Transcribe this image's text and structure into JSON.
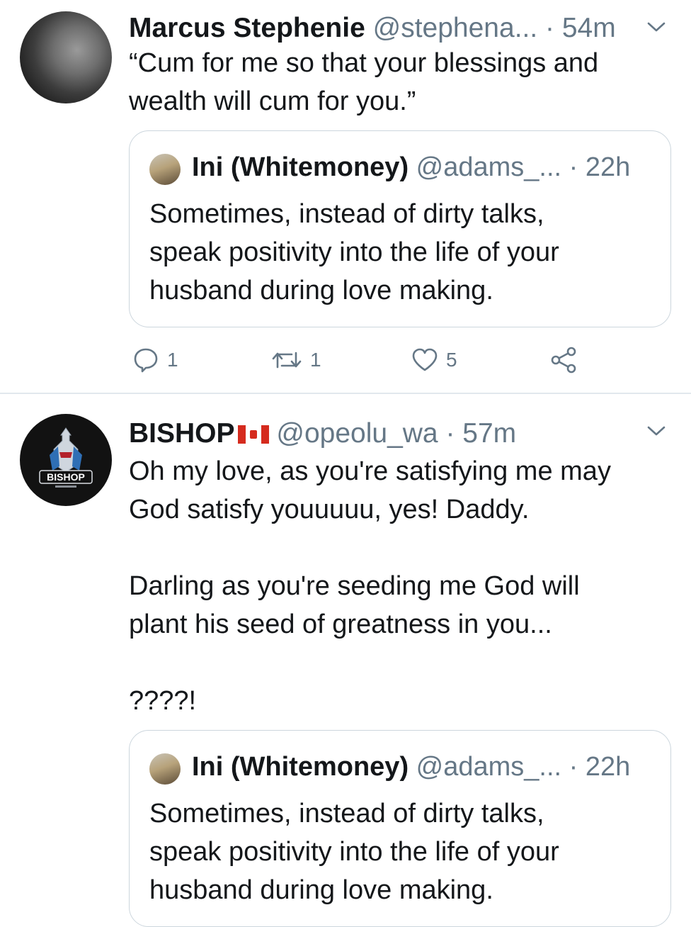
{
  "tweets": [
    {
      "display_name": "Marcus Stephenie",
      "handle": "@stephena...",
      "time": "· 54m",
      "text": "“Cum for me so that your blessings and\nwealth will cum for you.”",
      "quoted": {
        "display_name": "Ini (Whitemoney)",
        "handle": "@adams_...",
        "time": "· 22h",
        "text": "Sometimes, instead of dirty talks,\nspeak positivity into the life of your\nhusband during love making."
      },
      "actions": {
        "replies": "1",
        "retweets": "1",
        "likes": "5"
      }
    },
    {
      "display_name": "BISHOP",
      "flag": "🇨🇦",
      "handle": "@opeolu_wa",
      "time": "· 57m",
      "avatar_logo_text": "BISHOP",
      "text": "Oh my love, as you're satisfying me may\nGod satisfy youuuuu, yes! Daddy.\n\nDarling as you're seeding me God will\nplant his seed of greatness in you...\n\n????!",
      "quoted": {
        "display_name": "Ini (Whitemoney)",
        "handle": "@adams_...",
        "time": "· 22h",
        "text": "Sometimes, instead of dirty talks,\nspeak positivity into the life of your\nhusband during love making."
      }
    }
  ],
  "icons": {
    "reply": "reply-icon",
    "retweet": "retweet-icon",
    "like": "heart-icon",
    "share": "share-icon",
    "more": "chevron-down-icon"
  },
  "colors": {
    "text_primary": "#14171a",
    "text_secondary": "#657786",
    "border": "#ccd6dd"
  }
}
